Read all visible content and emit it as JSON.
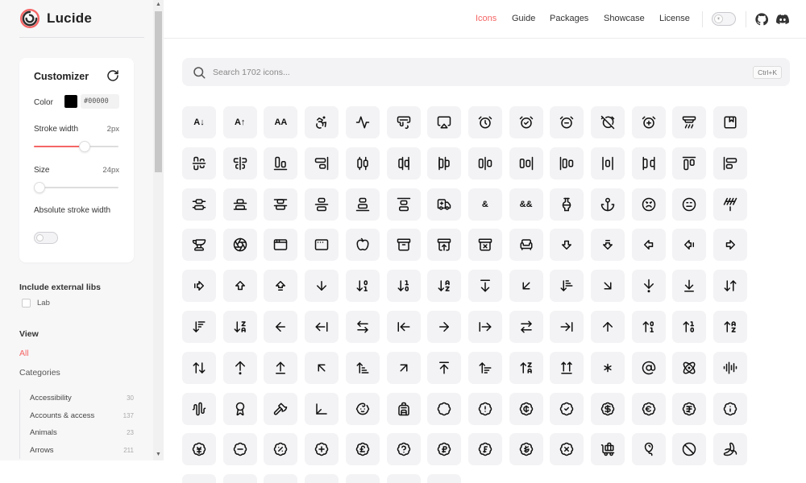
{
  "brand": {
    "name": "Lucide"
  },
  "nav": [
    "Icons",
    "Guide",
    "Packages",
    "Showcase",
    "License"
  ],
  "customizer": {
    "title": "Customizer",
    "color_label": "Color",
    "color_value": "#00000",
    "stroke_label": "Stroke width",
    "stroke_value": "2px",
    "stroke_fraction": 0.6,
    "size_label": "Size",
    "size_value": "24px",
    "size_fraction": 0.04,
    "abs_label": "Absolute stroke width",
    "abs_on": false
  },
  "external": {
    "title": "Include external libs",
    "lib": "Lab"
  },
  "view": {
    "title": "View",
    "all": "All"
  },
  "categories": {
    "title": "Categories",
    "items": [
      {
        "name": "Accessibility",
        "count": "30"
      },
      {
        "name": "Accounts & access",
        "count": "137"
      },
      {
        "name": "Animals",
        "count": "23"
      },
      {
        "name": "Arrows",
        "count": "211"
      }
    ]
  },
  "search": {
    "placeholder": "Search 1702 icons...",
    "shortcut": "Ctrl+K"
  },
  "accent_color": "#f56565",
  "icons": [
    "a-arrow-down",
    "a-arrow-up",
    "a-large-small",
    "accessibility",
    "activity",
    "air-vent",
    "airplay",
    "alarm-clock",
    "alarm-clock-check",
    "alarm-clock-minus",
    "alarm-clock-off",
    "alarm-clock-plus",
    "alarm-smoke",
    "album",
    "align-center-horizontal",
    "align-center-vertical",
    "align-end-horizontal",
    "align-end-vertical",
    "align-horizontal-distribute-center",
    "align-horizontal-distribute-end",
    "align-horizontal-distribute-start",
    "align-horizontal-justify-center",
    "align-horizontal-justify-end",
    "align-horizontal-justify-start",
    "align-horizontal-space-around",
    "align-horizontal-space-between",
    "align-start-horizontal",
    "align-start-vertical",
    "align-vertical-distribute-center",
    "align-vertical-distribute-end",
    "align-vertical-distribute-start",
    "align-vertical-justify-center",
    "align-vertical-justify-end",
    "align-vertical-justify-start",
    "ambulance",
    "ampersand",
    "ampersands",
    "amphora",
    "anchor",
    "angry",
    "annoyed",
    "antenna",
    "anvil",
    "aperture",
    "app-window",
    "app-window-mac",
    "apple",
    "archive",
    "archive-restore",
    "archive-x",
    "armchair",
    "arrow-big-down",
    "arrow-big-down-dash",
    "arrow-big-left",
    "arrow-big-left-dash",
    "arrow-big-right",
    "arrow-big-right-dash",
    "arrow-big-up",
    "arrow-big-up-dash",
    "arrow-down",
    "arrow-down-0-1",
    "arrow-down-1-0",
    "arrow-down-a-z",
    "arrow-down-from-line",
    "arrow-down-left",
    "arrow-down-narrow-wide",
    "arrow-down-right",
    "arrow-down-to-dot",
    "arrow-down-to-line",
    "arrow-down-up",
    "arrow-down-wide-narrow",
    "arrow-down-z-a",
    "arrow-left",
    "arrow-left-from-line",
    "arrow-left-right",
    "arrow-left-to-line",
    "arrow-right",
    "arrow-right-from-line",
    "arrow-right-left",
    "arrow-right-to-line",
    "arrow-up",
    "arrow-up-0-1",
    "arrow-up-1-0",
    "arrow-up-a-z",
    "arrow-up-down",
    "arrow-up-from-dot",
    "arrow-up-from-line",
    "arrow-up-left",
    "arrow-up-narrow-wide",
    "arrow-up-right",
    "arrow-up-to-line",
    "arrow-up-wide-narrow",
    "arrow-up-z-a",
    "arrows-up-from-line",
    "asterisk",
    "at-sign",
    "atom",
    "audio-lines",
    "audio-waveform",
    "award",
    "axe",
    "axis-3d",
    "baby",
    "backpack",
    "badge",
    "badge-alert",
    "badge-cent",
    "badge-check",
    "badge-dollar-sign",
    "badge-euro",
    "badge-indian-rupee",
    "badge-info",
    "badge-japanese-yen",
    "badge-minus",
    "badge-percent",
    "badge-plus",
    "badge-pound-sterling",
    "badge-question-mark",
    "badge-russian-ruble",
    "badge-swiss-franc",
    "badge-turkish-lira",
    "badge-x",
    "baggage-claim",
    "balloon",
    "ban",
    "banana",
    "bandage",
    "banknote",
    "banknote-arrow-down",
    "banknote-arrow-up",
    "banknote-x",
    "barcode",
    "baseline"
  ]
}
